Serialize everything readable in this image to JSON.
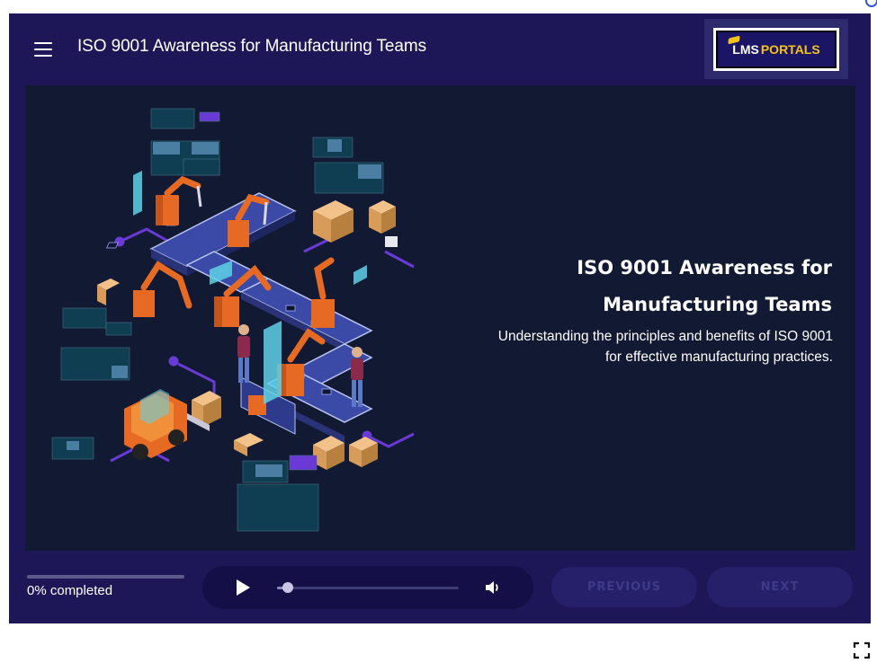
{
  "header": {
    "course_title": "ISO 9001 Awareness for Manufacturing Teams",
    "logo": {
      "text_left": "LMS",
      "text_right": "PORTALS"
    }
  },
  "slide": {
    "title_line1": "ISO 9001 Awareness for",
    "title_line2": "Manufacturing Teams",
    "subtitle_line1": "Understanding the principles and benefits of ISO 9001",
    "subtitle_line2": "for effective manufacturing practices."
  },
  "footer": {
    "progress_percent": 0,
    "progress_label": "0% completed",
    "audio_position_fraction": 0.06,
    "previous_label": "PREVIOUS",
    "next_label": "NEXT"
  },
  "icons": {
    "menu": "hamburger-icon",
    "play": "play-icon",
    "volume": "volume-icon",
    "fullscreen": "fullscreen-icon"
  },
  "colors": {
    "bar_background": "#1d1757",
    "slide_background": "#121a33",
    "conveyor_blue": "#3a4aa6",
    "robot_orange": "#e76a24",
    "accent_purple": "#6a3ad6",
    "logo_yellow": "#f7c21a"
  }
}
